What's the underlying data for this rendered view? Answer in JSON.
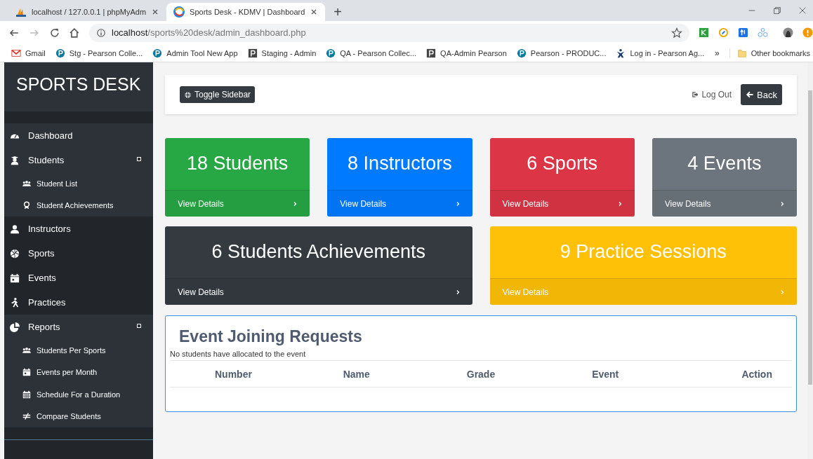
{
  "browser": {
    "tabs": [
      {
        "title": "localhost / 127.0.0.1 | phpMyAdm",
        "selected": false
      },
      {
        "title": "Sports Desk - KDMV | Dashboard",
        "selected": true
      }
    ],
    "new_tab": "+",
    "address": {
      "host": "localhost",
      "path": "/sports%20desk/admin_dashboard.php"
    },
    "bookmarks": [
      {
        "label": "Gmail"
      },
      {
        "label": "Stg - Pearson Colle..."
      },
      {
        "label": "Admin Tool New App"
      },
      {
        "label": "Staging - Admin"
      },
      {
        "label": "QA - Pearson Collec..."
      },
      {
        "label": "QA-Admin Pearson"
      },
      {
        "label": "Pearson - PRODUC..."
      },
      {
        "label": "Log in - Pearson Ag..."
      }
    ],
    "overflow": "»",
    "other_bookmarks": "Other bookmarks"
  },
  "sidebar": {
    "brand": "SPORTS DESK",
    "items": [
      {
        "label": "Dashboard",
        "expanded": false
      },
      {
        "label": "Students",
        "expanded": true,
        "children": [
          {
            "label": "Student List"
          },
          {
            "label": "Student Achievements"
          }
        ]
      },
      {
        "label": "Instructors",
        "expanded": false
      },
      {
        "label": "Sports",
        "expanded": false
      },
      {
        "label": "Events",
        "expanded": false
      },
      {
        "label": "Practices",
        "expanded": false
      },
      {
        "label": "Reports",
        "expanded": true,
        "children": [
          {
            "label": "Students Per Sports"
          },
          {
            "label": "Events per Month"
          },
          {
            "label": "Schedule For a Duration"
          },
          {
            "label": "Compare Students"
          }
        ]
      }
    ]
  },
  "topbar": {
    "toggle_button": "Toggle Sidebar",
    "logout_link": "Log Out",
    "back_button": "Back"
  },
  "cards": [
    {
      "label": "18 Students",
      "link": "View Details",
      "color": "#28a745",
      "kind": "single"
    },
    {
      "label": "8 Instructors",
      "link": "View Details",
      "color": "#007bff",
      "kind": "single"
    },
    {
      "label": "6 Sports",
      "link": "View Details",
      "color": "#dc3545",
      "kind": "single"
    },
    {
      "label": "4 Events",
      "link": "View Details",
      "color": "#6c757d",
      "kind": "single"
    },
    {
      "label": "6 Students Achievements",
      "link": "View Details",
      "color": "#343a40",
      "kind": "wide"
    },
    {
      "label": "9 Practice Sessions",
      "link": "View Details",
      "color": "#ffc107",
      "kind": "wide"
    }
  ],
  "requests": {
    "title": "Event Joining Requests",
    "message": "No students have allocated to the event",
    "columns": [
      "Number",
      "Name",
      "Grade",
      "Event",
      "Action"
    ]
  }
}
